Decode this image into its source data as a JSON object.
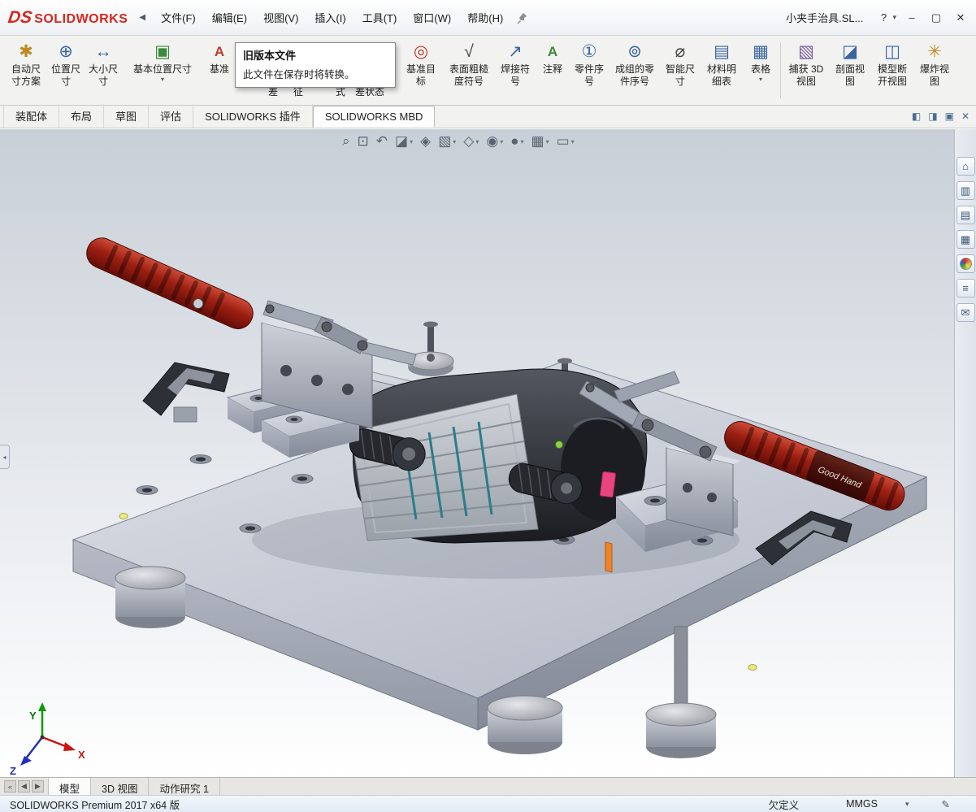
{
  "window": {
    "logo": "DS",
    "brand": "SOLIDWORKS",
    "menu_collapse": "◀",
    "doc_title": "小夹手治具.SL...",
    "help": "?",
    "help_caret": "▾",
    "minimize": "–",
    "maximize": "▢",
    "close": "✕"
  },
  "menu": {
    "items": [
      "文件(F)",
      "编辑(E)",
      "视图(V)",
      "插入(I)",
      "工具(T)",
      "窗口(W)",
      "帮助(H)"
    ]
  },
  "ribbon": {
    "caret": "▾",
    "fragments": [
      "差",
      "征",
      "式",
      "差状态"
    ],
    "items": [
      {
        "name": "auto-dimension-scheme",
        "l1": "自动尺",
        "l2": "寸方案",
        "glyph": "✱"
      },
      {
        "name": "location-dimension",
        "l1": "位置尺",
        "l2": "寸",
        "glyph": "⊕"
      },
      {
        "name": "size-dimension",
        "l1": "大小尺",
        "l2": "寸",
        "glyph": "↔"
      },
      {
        "name": "basic-location-dimension",
        "l1": "基本位置尺寸",
        "l2": "",
        "glyph": "▣"
      },
      {
        "name": "datum",
        "l1": "基准",
        "l2": "",
        "glyph": "A"
      },
      {
        "name": "datum-target",
        "l1": "基准目",
        "l2": "标",
        "glyph": "◎"
      },
      {
        "name": "surface-finish-symbol",
        "l1": "表面粗糙",
        "l2": "度符号",
        "glyph": "√"
      },
      {
        "name": "weld-symbol",
        "l1": "焊接符",
        "l2": "号",
        "glyph": "↗"
      },
      {
        "name": "note",
        "l1": "注释",
        "l2": "",
        "glyph": "A"
      },
      {
        "name": "balloon",
        "l1": "零件序",
        "l2": "号",
        "glyph": "①"
      },
      {
        "name": "auto-balloon",
        "l1": "成组的零",
        "l2": "件序号",
        "glyph": "⊚"
      },
      {
        "name": "smart-dimension",
        "l1": "智能尺",
        "l2": "寸",
        "glyph": "⌀"
      },
      {
        "name": "bill-of-materials",
        "l1": "材料明",
        "l2": "细表",
        "glyph": "▤"
      },
      {
        "name": "tables",
        "l1": "表格",
        "l2": "",
        "glyph": "▦"
      },
      {
        "name": "capture-3d-view",
        "l1": "捕获 3D",
        "l2": "视图",
        "glyph": "▧"
      },
      {
        "name": "section-view",
        "l1": "剖面视",
        "l2": "图",
        "glyph": "◪"
      },
      {
        "name": "model-break-view",
        "l1": "模型断",
        "l2": "开视图",
        "glyph": "◫"
      },
      {
        "name": "exploded-view",
        "l1": "爆炸视",
        "l2": "图",
        "glyph": "✳"
      }
    ]
  },
  "tooltip": {
    "title": "旧版本文件",
    "body": "此文件在保存时将转换。"
  },
  "doc_tabs": {
    "items": [
      "装配体",
      "布局",
      "草图",
      "评估",
      "SOLIDWORKS 插件",
      "SOLIDWORKS MBD"
    ]
  },
  "pane_controls": [
    "◧",
    "◨",
    "▣",
    "✕"
  ],
  "headsup": {
    "caret": "▾",
    "items": [
      {
        "name": "zoom-fit",
        "glyph": "⌕"
      },
      {
        "name": "zoom-area",
        "glyph": "⊡"
      },
      {
        "name": "previous-view",
        "glyph": "↶"
      },
      {
        "name": "section-view",
        "glyph": "◪"
      },
      {
        "name": "dynamic-annotation-views",
        "glyph": "◈"
      },
      {
        "name": "view-orientation",
        "glyph": "▧"
      },
      {
        "name": "display-style",
        "glyph": "◇"
      },
      {
        "name": "hide-show-items",
        "glyph": "◉"
      },
      {
        "name": "edit-appearance",
        "glyph": "●"
      },
      {
        "name": "apply-scene",
        "glyph": "▦"
      },
      {
        "name": "view-settings",
        "glyph": "▭"
      }
    ]
  },
  "taskpane": {
    "items": [
      {
        "name": "solidworks-resources",
        "glyph": "⌂"
      },
      {
        "name": "design-library",
        "glyph": "▥"
      },
      {
        "name": "file-explorer",
        "glyph": "▤"
      },
      {
        "name": "view-palette",
        "glyph": "▦"
      },
      {
        "name": "appearances-scenes",
        "glyph": ""
      },
      {
        "name": "custom-properties",
        "glyph": "≡"
      },
      {
        "name": "solidworks-forum",
        "glyph": "✉"
      }
    ]
  },
  "viewport": {
    "brand_text": "Good Hand",
    "flyout_glyph": "◂",
    "triad": {
      "x": "X",
      "y": "Y",
      "z": "Z"
    }
  },
  "bottom_tabs": {
    "nav": [
      "«",
      "◀",
      "▶"
    ],
    "items": [
      "模型",
      "3D 视图",
      "动作研究 1"
    ]
  },
  "statusbar": {
    "app": "SOLIDWORKS Premium 2017 x64 版",
    "state": "欠定义",
    "units": "MMGS",
    "units_caret": "▾",
    "edit_glyph": "✎"
  }
}
